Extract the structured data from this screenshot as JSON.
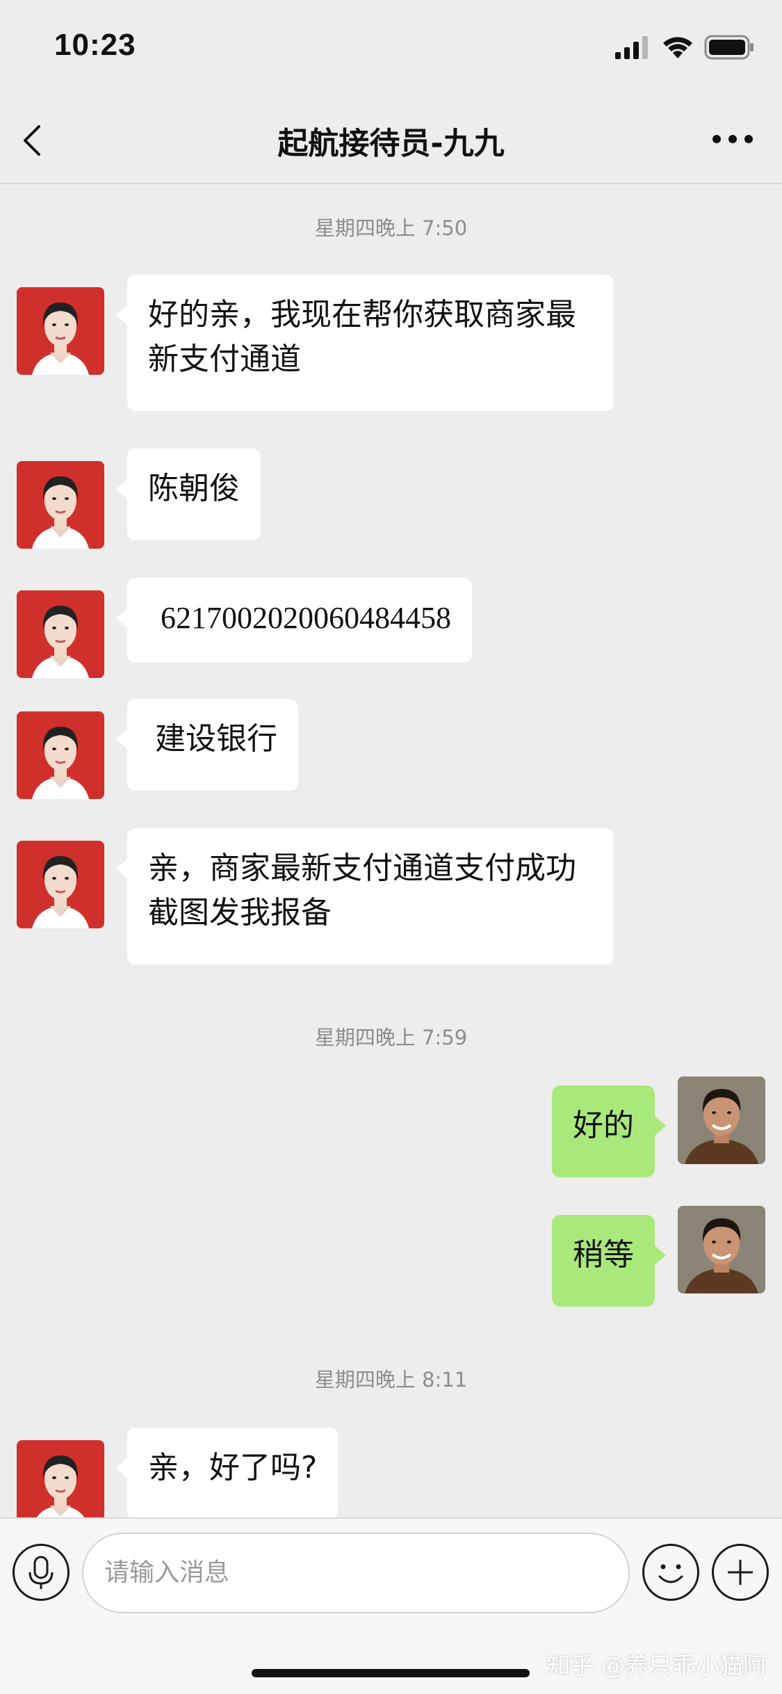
{
  "status_bar": {
    "time": "10:23"
  },
  "nav": {
    "title": "起航接待员-九九"
  },
  "chat": {
    "timestamps": [
      "星期四晚上 7:50",
      "星期四晚上 7:59",
      "星期四晚上 8:11"
    ],
    "messages": [
      {
        "side": "left",
        "text_line1": "好的亲，我现在帮你获取商家最",
        "text_line2": "新支付通道"
      },
      {
        "side": "left",
        "text": "陈朝俊"
      },
      {
        "side": "left",
        "text": "6217002020060484458"
      },
      {
        "side": "left",
        "text": "建设银行"
      },
      {
        "side": "left",
        "text_line1": "亲，商家最新支付通道支付成功",
        "text_line2": "截图发我报备"
      },
      {
        "side": "right",
        "text": "好的"
      },
      {
        "side": "right",
        "text": "稍等"
      },
      {
        "side": "left",
        "text": "亲，好了吗?"
      }
    ]
  },
  "input": {
    "placeholder": "请输入消息"
  },
  "watermark": "知乎 @养只乖小猫阿",
  "colors": {
    "background": "#ededed",
    "self_bubble": "#a9e97b",
    "other_bubble": "#ffffff",
    "avatar_bg": "#d0302c"
  },
  "icons": [
    "signal-icon",
    "wifi-icon",
    "battery-icon",
    "back-chevron-icon",
    "more-dots-icon",
    "microphone-icon",
    "emoji-icon",
    "plus-icon"
  ]
}
